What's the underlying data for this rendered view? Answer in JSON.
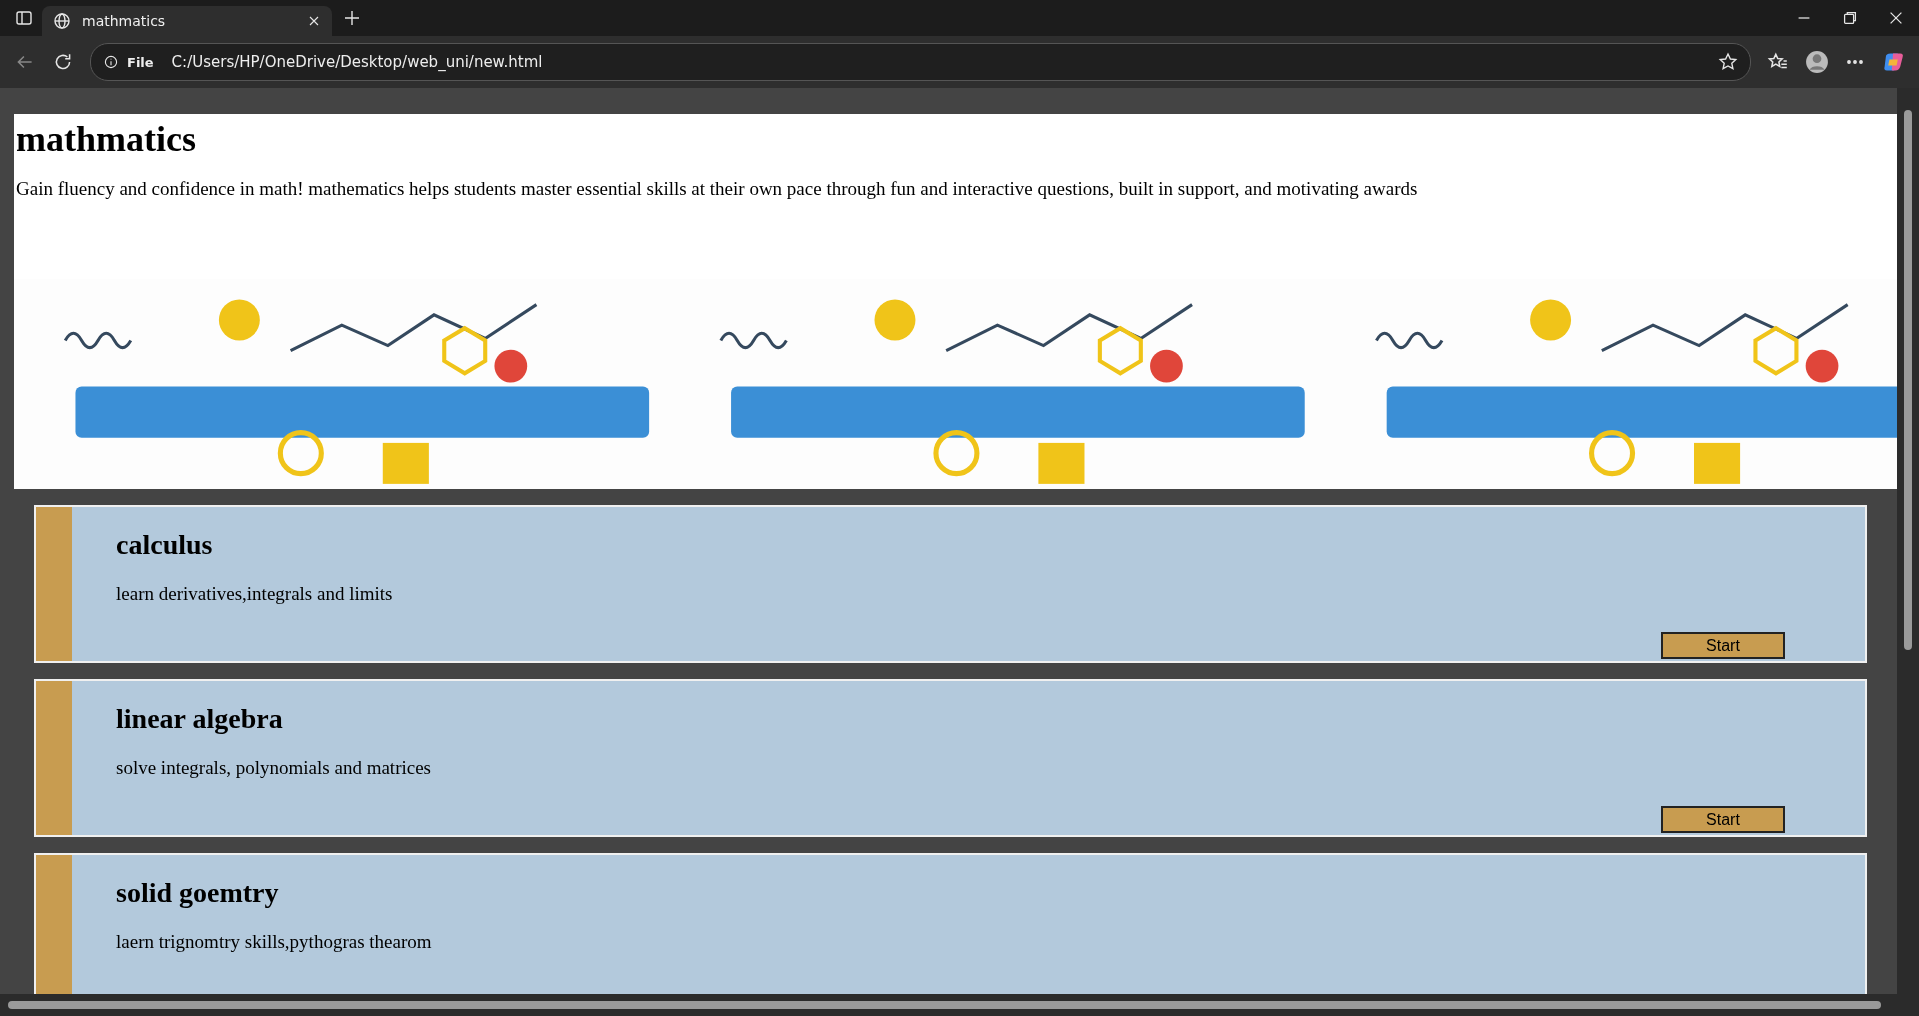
{
  "browser": {
    "tab": {
      "title": "mathmatics"
    },
    "address": {
      "scheme": "File",
      "url": "C:/Users/HP/OneDrive/Desktop/web_uni/new.html"
    }
  },
  "page": {
    "title": "mathmatics",
    "intro": "Gain fluency and confidence in math! mathematics helps students master essential skills at their own pace through fun and interactive questions, built in support, and motivating awards",
    "courses": [
      {
        "title": "calculus",
        "description": "learn derivatives,integrals and limits",
        "button": "Start"
      },
      {
        "title": "linear algebra",
        "description": "solve integrals, polynomials and matrices",
        "button": "Start"
      },
      {
        "title": "solid goemtry",
        "description": "laern trignomtry skills,pythogras thearom"
      }
    ]
  }
}
